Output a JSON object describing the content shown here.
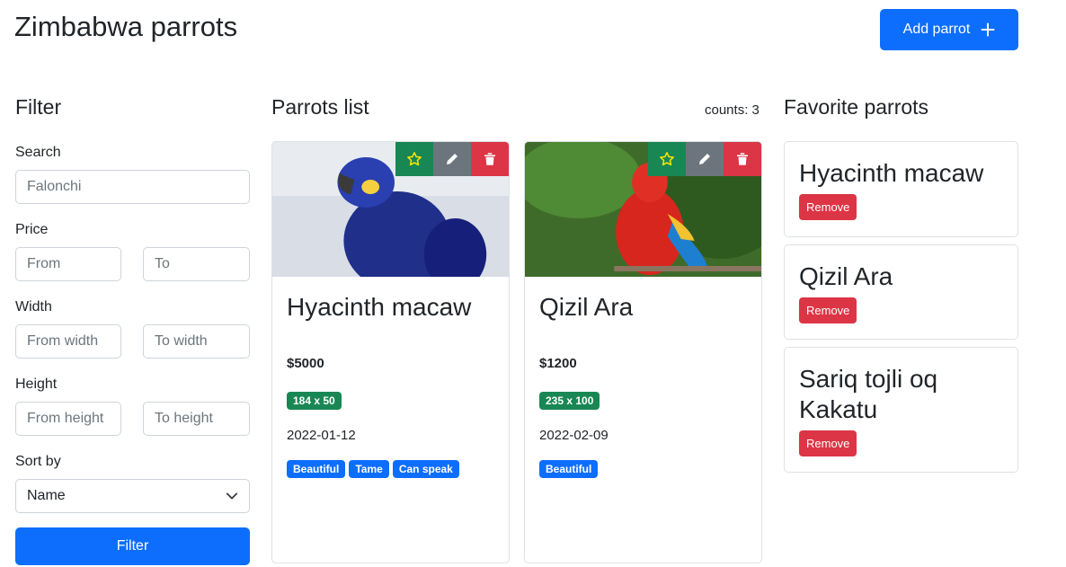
{
  "header": {
    "title": "Zimbabwa parrots",
    "add_button_label": "Add parrot"
  },
  "filter": {
    "title": "Filter",
    "search_label": "Search",
    "search_placeholder": "Falonchi",
    "price_label": "Price",
    "price_from_placeholder": "From",
    "price_to_placeholder": "To",
    "width_label": "Width",
    "width_from_placeholder": "From width",
    "width_to_placeholder": "To width",
    "height_label": "Height",
    "height_from_placeholder": "From height",
    "height_to_placeholder": "To height",
    "sort_label": "Sort by",
    "sort_selected": "Name",
    "filter_button_label": "Filter"
  },
  "list": {
    "title": "Parrots list",
    "counts": "counts: 3",
    "parrots": [
      {
        "name": "Hyacinth macaw",
        "price": "$5000",
        "size": "184 x 50",
        "date": "2022-01-12",
        "tags": [
          "Beautiful",
          "Tame",
          "Can speak"
        ]
      },
      {
        "name": "Qizil Ara",
        "price": "$1200",
        "size": "235 x 100",
        "date": "2022-02-09",
        "tags": [
          "Beautiful"
        ]
      }
    ]
  },
  "favorites": {
    "title": "Favorite parrots",
    "remove_label": "Remove",
    "items": [
      "Hyacinth macaw",
      "Qizil Ara",
      "Sariq tojli oq Kakatu"
    ]
  },
  "colors": {
    "primary": "#0d6efd",
    "success": "#198754",
    "secondary": "#6c757d",
    "danger": "#dc3545"
  },
  "icons": {
    "add": "plus-icon",
    "favorite": "star-icon",
    "edit": "pencil-icon",
    "delete": "trash-icon",
    "select": "chevron-down-icon"
  }
}
